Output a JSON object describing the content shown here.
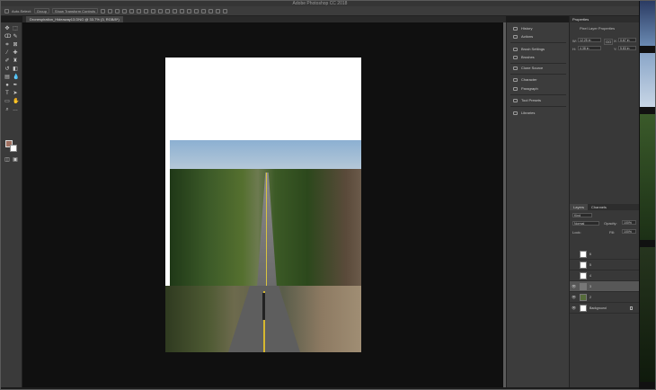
{
  "window": {
    "title": "Adobe Photoshop CC 2018"
  },
  "options_bar": {
    "auto_select": "Auto-Select:",
    "group_value": "Group",
    "transform_controls": "Show Transform Controls"
  },
  "document_tab": {
    "label": "Dronespiration_Hideaway13.DNG @ 33.7% (3, RGB/8*)"
  },
  "dock": {
    "items": [
      {
        "label": "History",
        "icon": "history-icon"
      },
      {
        "label": "Actions",
        "icon": "actions-icon"
      },
      {
        "label": "Brush Settings",
        "icon": "brush-settings-icon"
      },
      {
        "label": "Brushes",
        "icon": "brushes-icon"
      },
      {
        "label": "Clone Source",
        "icon": "clone-source-icon"
      },
      {
        "label": "Character",
        "icon": "character-icon"
      },
      {
        "label": "Paragraph",
        "icon": "paragraph-icon"
      },
      {
        "label": "Tool Presets",
        "icon": "tool-presets-icon"
      },
      {
        "label": "Libraries",
        "icon": "libraries-icon"
      }
    ]
  },
  "properties": {
    "title": "Properties",
    "subtitle": "Pixel Layer Properties",
    "w_label": "W:",
    "w_value": "12.25 in",
    "go_label": "GO",
    "x_label": "X:",
    "x_value": "0.67 in",
    "h_label": "H:",
    "h_value": "4.38 in",
    "y_label": "Y:",
    "y_value": "5.83 in"
  },
  "layers": {
    "tabs": [
      "Layers",
      "Channels"
    ],
    "kind": "Kind",
    "blend_mode": "Normal",
    "opacity_label": "Opacity:",
    "opacity_value": "100%",
    "lock_label": "Lock:",
    "fill_label": "Fill:",
    "fill_value": "100%",
    "rows": [
      {
        "name": "6",
        "visible": false,
        "selected": false
      },
      {
        "name": "5",
        "visible": false,
        "selected": false
      },
      {
        "name": "4",
        "visible": false,
        "selected": false
      },
      {
        "name": "3",
        "visible": true,
        "selected": true
      },
      {
        "name": "2",
        "visible": true,
        "selected": false
      },
      {
        "name": "Background",
        "visible": true,
        "selected": false
      }
    ]
  },
  "colors": {
    "foreground": "#a07060",
    "background": "#ffffff",
    "canvas_bg": "#101010",
    "panel_bg": "#383838"
  }
}
